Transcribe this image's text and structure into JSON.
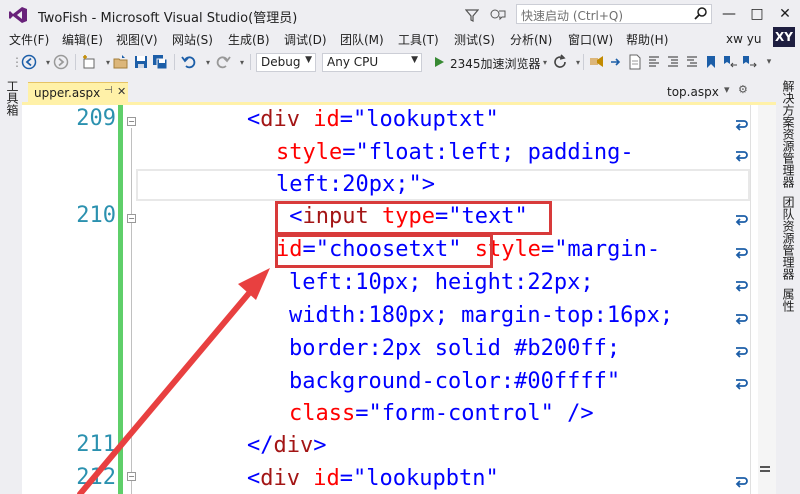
{
  "window": {
    "title": "TwoFish - Microsoft Visual Studio(管理员)",
    "quick_launch_placeholder": "快速启动 (Ctrl+Q)",
    "minimize": "—",
    "maximize": "□",
    "close": "✕"
  },
  "menu": [
    "文件(F)",
    "编辑(E)",
    "视图(V)",
    "网站(S)",
    "生成(B)",
    "调试(D)",
    "团队(M)",
    "工具(T)",
    "测试(S)",
    "分析(N)",
    "窗口(W)",
    "帮助(H)"
  ],
  "user": {
    "name": "xw yu",
    "initials": "XY"
  },
  "toolbar": {
    "config": "Debug",
    "platform": "Any CPU",
    "browser": "2345加速浏览器"
  },
  "side_panels": {
    "left": "工具箱",
    "right": [
      "解决方案资源管理器",
      "团队资源管理器",
      "属性"
    ]
  },
  "tabs": {
    "active": "upper.aspx",
    "pin_glyph": "⊣",
    "close_glyph": "✕",
    "other": "top.aspx"
  },
  "editor": {
    "line_numbers": [
      "209",
      "210",
      "211",
      "212"
    ]
  },
  "colors": {
    "keyword": "#0000ff",
    "tag": "#a31515",
    "attribute": "#ff0000",
    "highlight_box": "#d83a3a",
    "arrow": "#e84040",
    "change_bar": "#5fcf6a"
  }
}
